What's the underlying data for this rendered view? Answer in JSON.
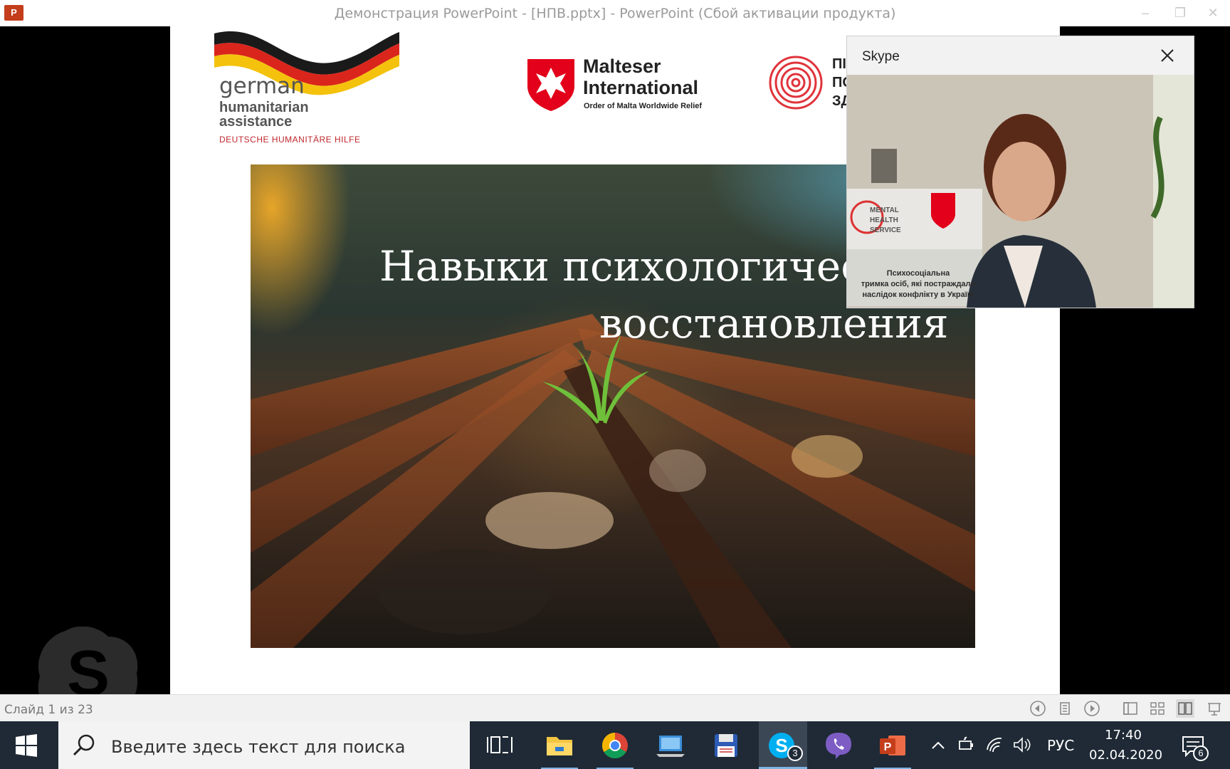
{
  "window": {
    "title": "Демонстрация PowerPoint - [НПВ.pptx] - PowerPoint (Сбой активации продукта)",
    "app_icon": "P",
    "controls": {
      "minimize": "–",
      "restore": "❐",
      "close": "✕"
    }
  },
  "slide": {
    "logos": {
      "german": {
        "line1": "german",
        "line2": "humanitarian",
        "line3": "assistance",
        "line4": "DEUTSCHE HUMANITÄRE HILFE"
      },
      "malteser": {
        "line1": "Malteser",
        "line2": "International",
        "line3": "Order of Malta Worldwide Relief"
      },
      "mental_health": {
        "line1": "ПІД",
        "line2": "ПО",
        "line3": "ЗД"
      }
    },
    "title_line1": "Навыки психологичес",
    "title_line2": "восстановления"
  },
  "skype_window": {
    "title": "Skype",
    "poster": {
      "line1": "MENTAL",
      "line2": "HEALTH",
      "line3": "SERVICE",
      "caption1": "Психосоціальна",
      "caption2": "тримка осіб, які постраждали",
      "caption3": "наслідок конфлікту в Україні"
    }
  },
  "statusbar": {
    "slide_counter": "Слайд 1 из 23"
  },
  "taskbar": {
    "search_placeholder": "Введите здесь текст для поиска",
    "skype_badge": "3",
    "tray_language": "РУС",
    "time": "17:40",
    "date": "02.04.2020",
    "notifications_count": "6"
  },
  "colors": {
    "taskbar_bg": "#1f2a36",
    "powerpoint_red": "#c43e1c",
    "malteser_red": "#e2001a",
    "skype_blue": "#00aff0"
  }
}
